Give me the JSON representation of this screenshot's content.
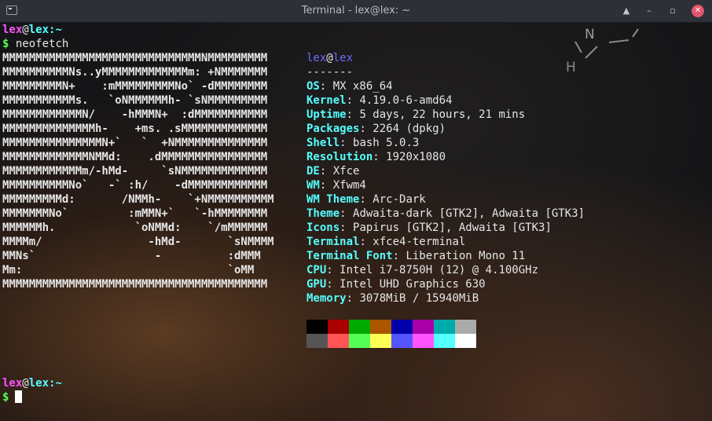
{
  "window": {
    "title": "Terminal - lex@lex: ~",
    "controls": [
      "▲",
      "–",
      "▫",
      "✕"
    ]
  },
  "prompt": {
    "user": "lex",
    "at": "@",
    "host": "lex",
    "path": ":~",
    "dollar": "$"
  },
  "command": "neofetch",
  "logo_lines": [
    "MMMMMMMMMMMMMMMMMMMMMMMMMMMMMMNMMMMMMMMM",
    "MMMMMMMMMMNs..yMMMMMMMMMMMMMm: +NMMMMMMM",
    "MMMMMMMMMN+    :mMMMMMMMMMNo` -dMMMMMMMM",
    "MMMMMMMMMMMs.   `oNMMMMMMh- `sNMMMMMMMMM",
    "MMMMMMMMMMMMN/    -hMMMN+  :dMMMMMMMMMMM",
    "MMMMMMMMMMMMMMh-    +ms. .sMMMMMMMMMMMMM",
    "MMMMMMMMMMMMMMMN+`   `  +NMMMMMMMMMMMMMM",
    "MMMMMMMMMMMMMNMMd:    .dMMMMMMMMMMMMMMMM",
    "MMMMMMMMMMMMm/-hMd-     `sNMMMMMMMMMMMMM",
    "MMMMMMMMMMNo`   -` :h/    -dMMMMMMMMMMMM",
    "MMMMMMMMMd:       /NMMh-    `+NMMMMMMMMMM",
    "MMMMMMMNo`         :mMMN+`   `-hMMMMMMMM",
    "MMMMMMh.            `oNMMd:    `/mMMMMMM",
    "MMMMm/                -hMd-       `sNMMMM",
    "MMNs`                  -          :dMMM",
    "Mm:                               `oMM",
    "MMMMMMMMMMMMMMMMMMMMMMMMMMMMMMMMMMMMMMMM"
  ],
  "neofetch": {
    "user": "lex",
    "at": "@",
    "host": "lex",
    "separator": "-------",
    "info": [
      {
        "key": "OS",
        "value": "MX x86_64"
      },
      {
        "key": "Kernel",
        "value": "4.19.0-6-amd64"
      },
      {
        "key": "Uptime",
        "value": "5 days, 22 hours, 21 mins"
      },
      {
        "key": "Packages",
        "value": "2264 (dpkg)"
      },
      {
        "key": "Shell",
        "value": "bash 5.0.3"
      },
      {
        "key": "Resolution",
        "value": "1920x1080"
      },
      {
        "key": "DE",
        "value": "Xfce"
      },
      {
        "key": "WM",
        "value": "Xfwm4"
      },
      {
        "key": "WM Theme",
        "value": "Arc-Dark"
      },
      {
        "key": "Theme",
        "value": "Adwaita-dark [GTK2], Adwaita [GTK3]"
      },
      {
        "key": "Icons",
        "value": "Papirus [GTK2], Adwaita [GTK3]"
      },
      {
        "key": "Terminal",
        "value": "xfce4-terminal"
      },
      {
        "key": "Terminal Font",
        "value": "Liberation Mono 11"
      },
      {
        "key": "CPU",
        "value": "Intel i7-8750H (12) @ 4.100GHz"
      },
      {
        "key": "GPU",
        "value": "Intel UHD Graphics 630"
      },
      {
        "key": "Memory",
        "value": "3078MiB / 15940MiB"
      }
    ],
    "palette_row1": [
      "#000000",
      "#aa0000",
      "#00aa00",
      "#aa5500",
      "#0000aa",
      "#aa00aa",
      "#00aaaa",
      "#aaaaaa"
    ],
    "palette_row2": [
      "#555555",
      "#ff5555",
      "#55ff55",
      "#ffff55",
      "#5555ff",
      "#ff55ff",
      "#55ffff",
      "#ffffff"
    ]
  },
  "wallpaper_glyphs": {
    "n": "N",
    "h": "H"
  }
}
